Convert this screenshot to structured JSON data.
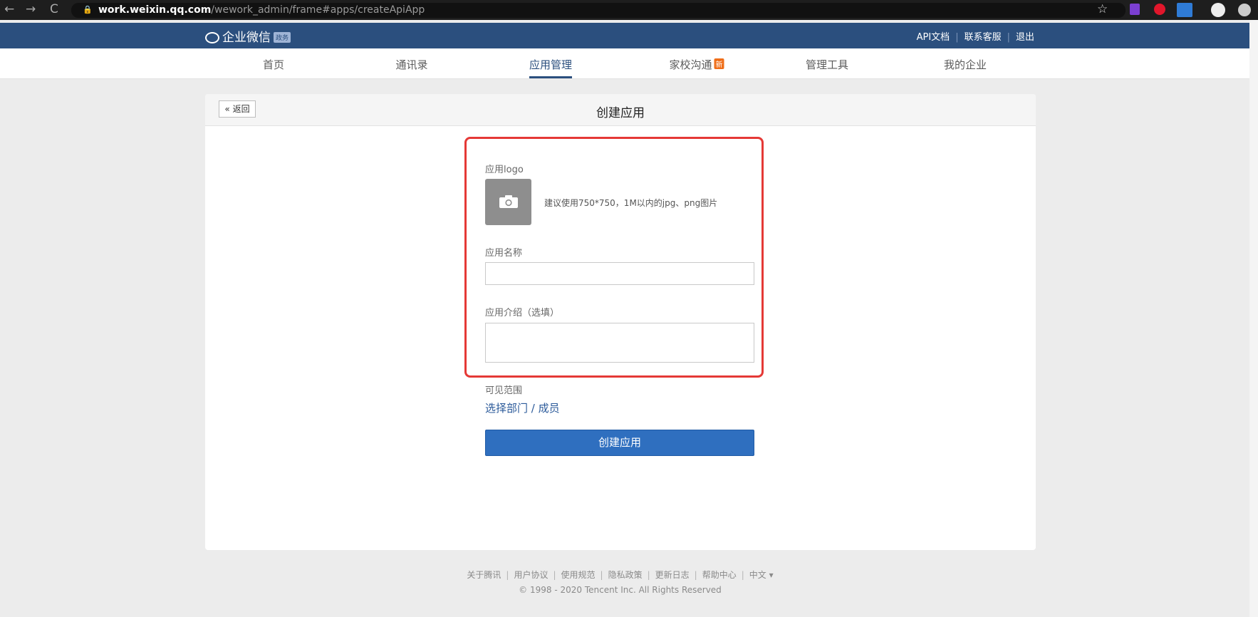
{
  "browser": {
    "back_icon": "←",
    "forward_icon": "→",
    "reload_icon": "C",
    "url_host": "work.weixin.qq.com",
    "url_path": "/wework_admin/frame#apps/createApiApp",
    "star_icon": "☆"
  },
  "header": {
    "brand": "企业微信",
    "brand_badge": "政务",
    "links": [
      "API文档",
      "联系客服",
      "退出"
    ]
  },
  "nav": {
    "tabs": [
      "首页",
      "通讯录",
      "应用管理",
      "家校沟通",
      "管理工具",
      "我的企业"
    ],
    "active_tab": "应用管理",
    "new_badge": "新"
  },
  "card": {
    "back_label": "« 返回",
    "title": "创建应用"
  },
  "form": {
    "logo_label": "应用logo",
    "logo_hint": "建议使用750*750，1M以内的jpg、png图片",
    "name_label": "应用名称",
    "name_value": "",
    "intro_label": "应用介绍（选填）",
    "intro_value": "",
    "scope_label": "可见范围",
    "scope_link": "选择部门 / 成员",
    "submit_label": "创建应用"
  },
  "footer": {
    "links": [
      "关于腾讯",
      "用户协议",
      "使用规范",
      "隐私政策",
      "更新日志",
      "帮助中心",
      "中文 ▾"
    ],
    "copyright": "© 1998 - 2020 Tencent Inc. All Rights Reserved"
  },
  "colors": {
    "header_bg": "#2b4f7e",
    "highlight": "#e53936",
    "primary_button": "#2f6fbf",
    "link": "#2b5a9a"
  }
}
